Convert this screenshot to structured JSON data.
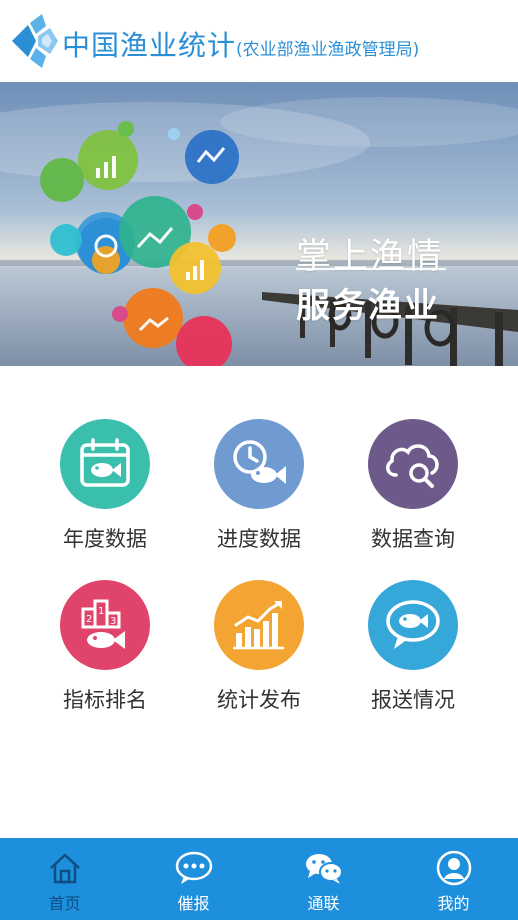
{
  "header": {
    "title": "中国渔业统计",
    "subtitle": "(农业部渔业渔政管理局)"
  },
  "banner": {
    "line1": "掌上渔情",
    "line2": "服务渔业"
  },
  "menu": [
    {
      "label": "年度数据",
      "icon": "calendar-fish-icon",
      "color": "#3bbfad"
    },
    {
      "label": "进度数据",
      "icon": "clock-fish-icon",
      "color": "#6f9bd1"
    },
    {
      "label": "数据查询",
      "icon": "cloud-search-icon",
      "color": "#6e5a8a"
    },
    {
      "label": "指标排名",
      "icon": "podium-fish-icon",
      "color": "#e1446b"
    },
    {
      "label": "统计发布",
      "icon": "bar-chart-icon",
      "color": "#f3a432"
    },
    {
      "label": "报送情况",
      "icon": "chat-fish-icon",
      "color": "#35a7d8"
    }
  ],
  "tabbar": {
    "items": [
      {
        "label": "首页",
        "icon": "home-icon"
      },
      {
        "label": "催报",
        "icon": "chat-bubble-icon"
      },
      {
        "label": "通联",
        "icon": "wechat-icon"
      },
      {
        "label": "我的",
        "icon": "user-icon"
      }
    ],
    "active_color": "#0f4e82",
    "bar_color": "#1e8fdd"
  }
}
